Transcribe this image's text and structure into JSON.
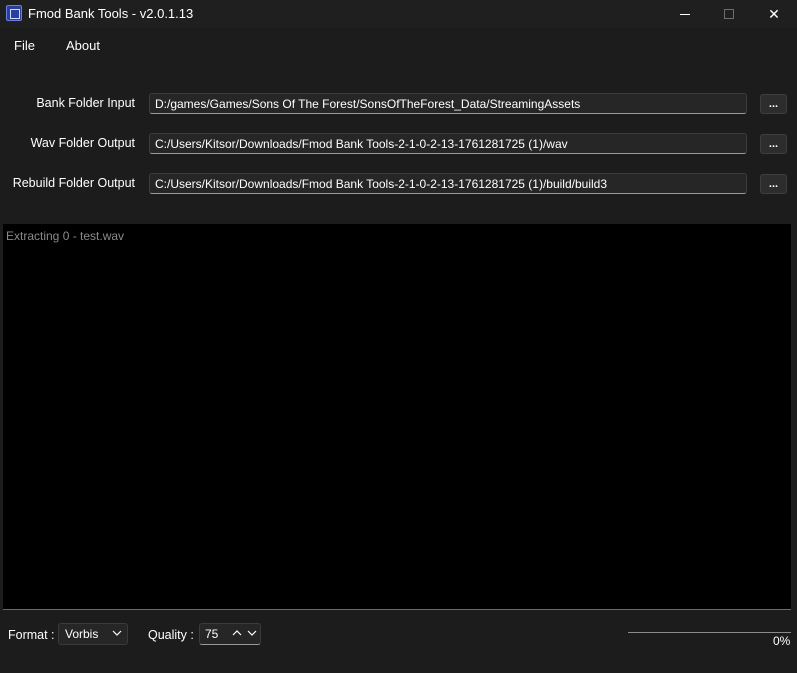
{
  "window": {
    "title": "Fmod Bank Tools - v2.0.1.13",
    "minimize_icon": "minimize-icon",
    "maximize_icon": "maximize-icon",
    "close_glyph": "✕"
  },
  "menu": {
    "file": "File",
    "about": "About"
  },
  "fields": {
    "bank_input": {
      "label": "Bank Folder Input",
      "value": "D:/games/Games/Sons Of The Forest/SonsOfTheForest_Data/StreamingAssets",
      "browse": "..."
    },
    "wav_output": {
      "label": "Wav Folder Output",
      "value": "C:/Users/Kitsor/Downloads/Fmod Bank Tools-2-1-0-2-13-1761281725 (1)/wav",
      "browse": "..."
    },
    "rebuild_output": {
      "label": "Rebuild Folder Output",
      "value": "C:/Users/Kitsor/Downloads/Fmod Bank Tools-2-1-0-2-13-1761281725 (1)/build/build3",
      "browse": "..."
    }
  },
  "log": {
    "lines": [
      "Extracting 0 - test.wav"
    ]
  },
  "bottom": {
    "format_label": "Format :",
    "format_value": "Vorbis",
    "quality_label": "Quality :",
    "quality_value": "75",
    "progress_percent": 0,
    "progress_text": "0%"
  },
  "colors": {
    "background": "#1c1c1c",
    "log_background": "#000000",
    "log_text": "#8a8a8a",
    "log_border": "#b04a5a",
    "accent": "#60a0ff"
  },
  "icons": {
    "app": "fmod-app-icon",
    "format_dropdown": "chevron-down-icon",
    "spin_up": "chevron-up-icon",
    "spin_down": "chevron-down-icon"
  }
}
